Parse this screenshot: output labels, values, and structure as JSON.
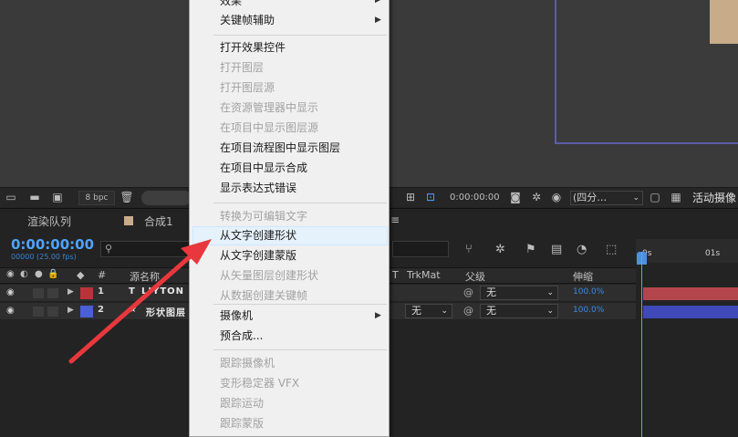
{
  "viewer_bar": {
    "bpc": "8 bpc",
    "timecode": "0:00:00:00",
    "resolution": "(四分…",
    "active_camera": "活动摄像"
  },
  "panel": {
    "tabs": [
      "渲染队列",
      "合成1"
    ]
  },
  "timeline": {
    "timecode": "0:00:00:00",
    "fps": "00000 (25.00 fps)",
    "ruler": [
      "0s",
      "01s"
    ],
    "columns": {
      "number": "#",
      "source_name": "源名称",
      "t": "T",
      "trkmat": "TrkMat",
      "parent": "父级",
      "stretch": "伸缩"
    },
    "layers": [
      {
        "number": "1",
        "type": "T",
        "name": "LIYTON",
        "trkmat": "",
        "parent": "无",
        "stretch": "100.0%",
        "label_color": "#b8343a",
        "bar_color": "#b3464c"
      },
      {
        "number": "2",
        "type": "★",
        "name": "形状图层",
        "trkmat": "无",
        "parent": "无",
        "stretch": "100.0%",
        "label_color": "#4b5fd6",
        "bar_color": "#3f49b8"
      }
    ]
  },
  "context_menu": {
    "items": [
      {
        "label": "效果",
        "disabled": false,
        "submenu": true
      },
      {
        "label": "关键帧辅助",
        "disabled": false,
        "submenu": true
      },
      {
        "label": "打开效果控件",
        "disabled": false
      },
      {
        "label": "打开图层",
        "disabled": true
      },
      {
        "label": "打开图层源",
        "disabled": true
      },
      {
        "label": "在资源管理器中显示",
        "disabled": true
      },
      {
        "label": "在项目中显示图层源",
        "disabled": true
      },
      {
        "label": "在项目流程图中显示图层",
        "disabled": false
      },
      {
        "label": "在项目中显示合成",
        "disabled": false
      },
      {
        "label": "显示表达式错误",
        "disabled": false
      },
      {
        "label": "转换为可编辑文字",
        "disabled": true
      },
      {
        "label": "从文字创建形状",
        "disabled": false,
        "highlighted": true
      },
      {
        "label": "从文字创建蒙版",
        "disabled": false
      },
      {
        "label": "从矢量图层创建形状",
        "disabled": true
      },
      {
        "label": "从数据创建关键帧",
        "disabled": true
      },
      {
        "label": "摄像机",
        "disabled": false,
        "submenu": true
      },
      {
        "label": "预合成...",
        "disabled": false
      },
      {
        "label": "跟踪摄像机",
        "disabled": true
      },
      {
        "label": "变形稳定器 VFX",
        "disabled": true
      },
      {
        "label": "跟踪运动",
        "disabled": true
      },
      {
        "label": "跟踪蒙版",
        "disabled": true
      }
    ]
  },
  "annotation": {
    "arrow_color": "#e8383d"
  }
}
